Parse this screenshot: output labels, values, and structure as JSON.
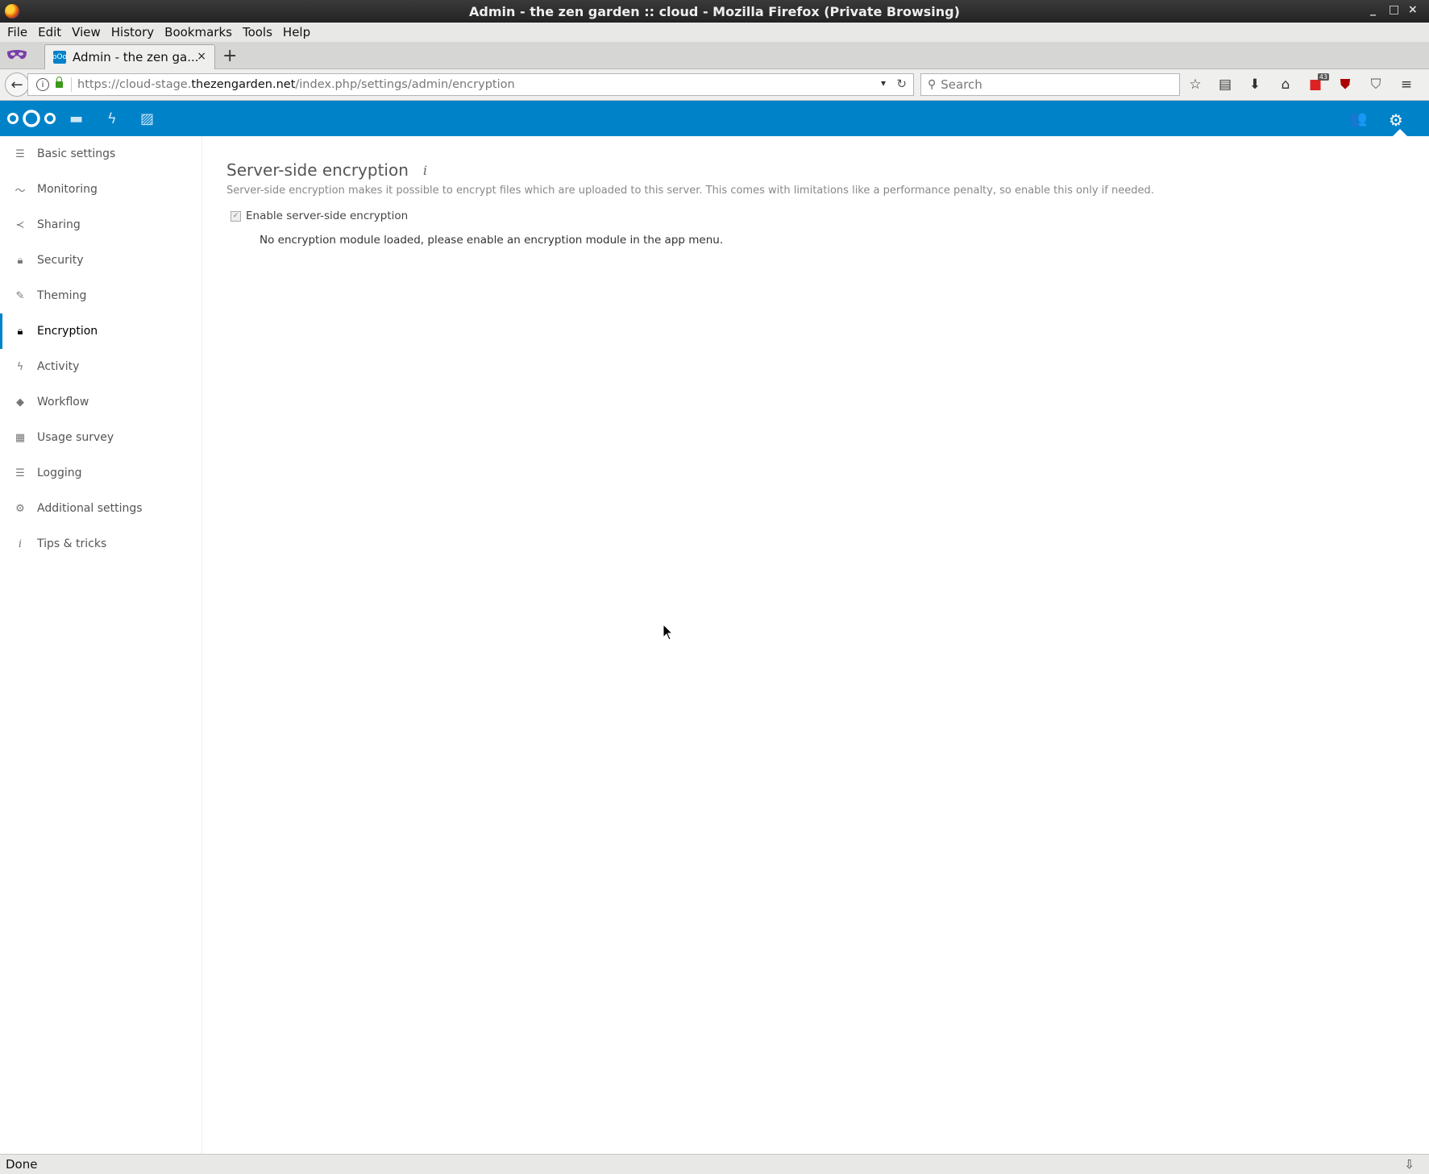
{
  "window": {
    "title": "Admin - the zen garden :: cloud - Mozilla Firefox (Private Browsing)",
    "controls": [
      "_",
      "□",
      "×"
    ]
  },
  "menu": [
    "File",
    "Edit",
    "View",
    "History",
    "Bookmarks",
    "Tools",
    "Help"
  ],
  "tab": {
    "title": "Admin - the zen ga...",
    "close": "×",
    "new": "+"
  },
  "urlbar": {
    "prefix": "https://cloud-stage.",
    "domain": "thezengarden.net",
    "path": "/index.php/settings/admin/encryption"
  },
  "search": {
    "placeholder": "Search"
  },
  "toolbar": {
    "badge_count": "43"
  },
  "sidebar": {
    "items": [
      {
        "label": "Basic settings",
        "icon": "list-icon"
      },
      {
        "label": "Monitoring",
        "icon": "pulse-icon"
      },
      {
        "label": "Sharing",
        "icon": "share-icon"
      },
      {
        "label": "Security",
        "icon": "lock-icon"
      },
      {
        "label": "Theming",
        "icon": "brush-icon"
      },
      {
        "label": "Encryption",
        "icon": "lock-icon",
        "active": true
      },
      {
        "label": "Activity",
        "icon": "bolt-icon"
      },
      {
        "label": "Workflow",
        "icon": "tag-icon"
      },
      {
        "label": "Usage survey",
        "icon": "survey-icon"
      },
      {
        "label": "Logging",
        "icon": "list-icon"
      },
      {
        "label": "Additional settings",
        "icon": "gear-icon"
      },
      {
        "label": "Tips & tricks",
        "icon": "info-icon"
      }
    ]
  },
  "main": {
    "title": "Server-side encryption",
    "info_glyph": "i",
    "description": "Server-side encryption makes it possible to encrypt files which are uploaded to this server. This comes with limitations like a performance penalty, so enable this only if needed.",
    "checkbox_label": "Enable server-side encryption",
    "checkbox_checked": true,
    "notice": "No encryption module loaded, please enable an encryption module in the app menu."
  },
  "status": {
    "text": "Done"
  },
  "colors": {
    "brand": "#0082c9"
  }
}
